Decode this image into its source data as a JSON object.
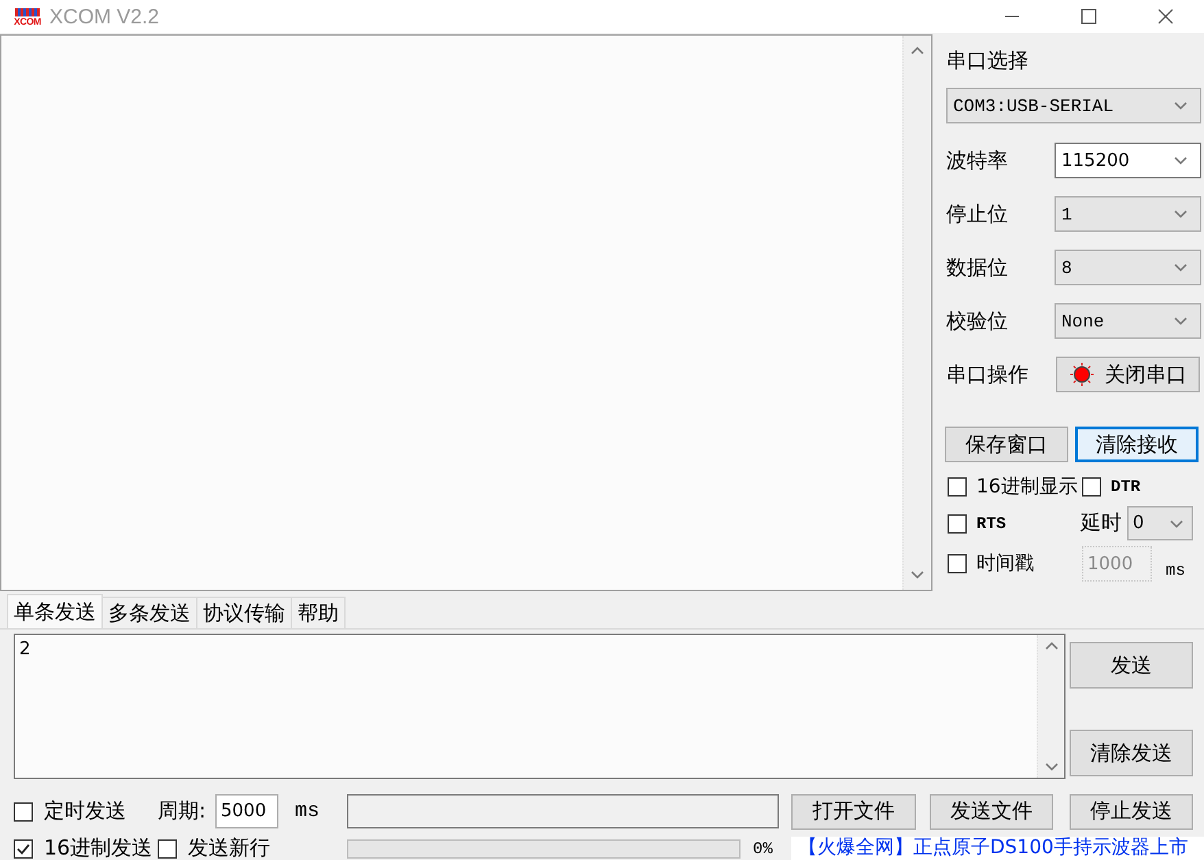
{
  "window": {
    "logo": "XCOM",
    "title": "XCOM V2.2"
  },
  "serial_panel": {
    "port": {
      "label": "串口选择",
      "value": "COM3:USB-SERIAL"
    },
    "fields": [
      {
        "label": "波特率",
        "value": "115200",
        "kind": "editable"
      },
      {
        "label": "停止位",
        "value": "1",
        "kind": "dropdown"
      },
      {
        "label": "数据位",
        "value": "8",
        "kind": "dropdown"
      },
      {
        "label": "校验位",
        "value": "None",
        "kind": "dropdown"
      }
    ],
    "operation": {
      "label": "串口操作",
      "button": "关闭串口",
      "on": true
    },
    "buttons": [
      {
        "label": "保存窗口",
        "focused": false
      },
      {
        "label": "清除接收",
        "focused": true
      }
    ],
    "options": [
      {
        "kind": "checkbox",
        "label": "16进制显示",
        "checked": false
      },
      {
        "kind": "checkbox",
        "label": "DTR",
        "checked": false
      },
      {
        "kind": "checkbox",
        "label": "RTS",
        "checked": false
      },
      {
        "kind": "dropdown",
        "label": "延时",
        "value": "0"
      },
      {
        "kind": "checkbox",
        "label": "时间戳",
        "checked": false
      },
      {
        "kind": "input",
        "value": "1000",
        "unit": "ms",
        "disabled": true
      }
    ]
  },
  "tabs": [
    {
      "label": "单条发送",
      "selected": true
    },
    {
      "label": "多条发送",
      "selected": false
    },
    {
      "label": "协议传输",
      "selected": false
    },
    {
      "label": "帮助",
      "selected": false
    }
  ],
  "send": {
    "value": "2",
    "buttons": [
      "发送",
      "清除发送"
    ]
  },
  "timer_row": {
    "timer": {
      "label": "定时发送",
      "checked": false
    },
    "period_label": "周期:",
    "period": "5000",
    "unit": "ms",
    "file_buttons": [
      "打开文件",
      "发送文件",
      "停止发送"
    ]
  },
  "options_row": {
    "checks": [
      {
        "label": "16进制发送",
        "checked": true
      },
      {
        "label": "发送新行",
        "checked": false
      }
    ],
    "progress": {
      "level": 0,
      "reading": "0%"
    },
    "link": "【火爆全网】正点原子DS100手持示波器上市"
  }
}
